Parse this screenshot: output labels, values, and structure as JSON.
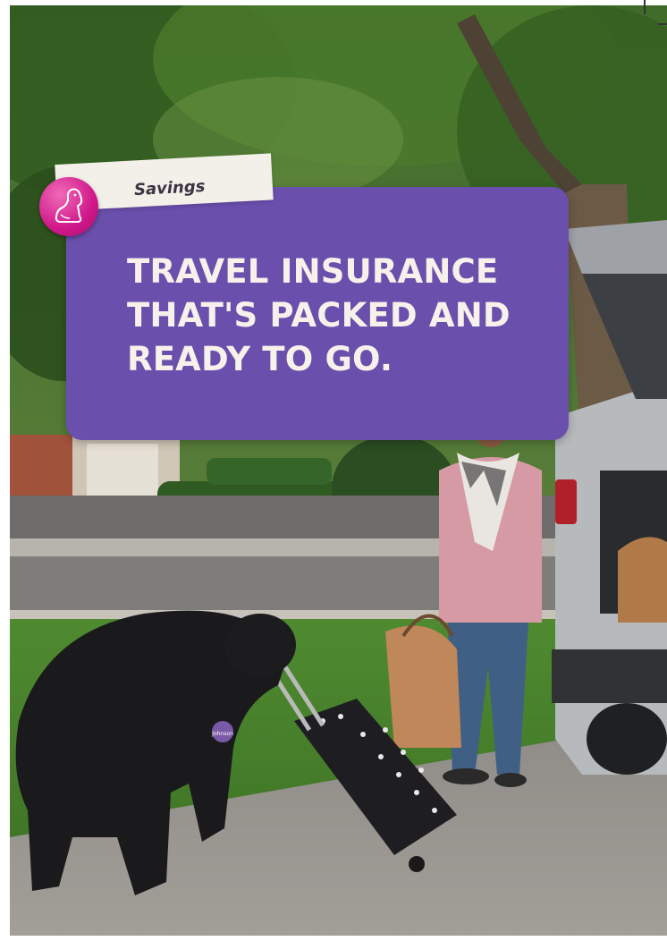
{
  "promo": {
    "category_label": "Savings",
    "headline": [
      "TRAVEL INSURANCE",
      "THAT'S PACKED AND",
      "READY TO GO."
    ],
    "card_color": "#6a4fac",
    "badge_color": "#d0188a"
  },
  "photo": {
    "collar_tag_text": "Johnson"
  },
  "icons": {
    "badge_icon": "dog-icon"
  }
}
